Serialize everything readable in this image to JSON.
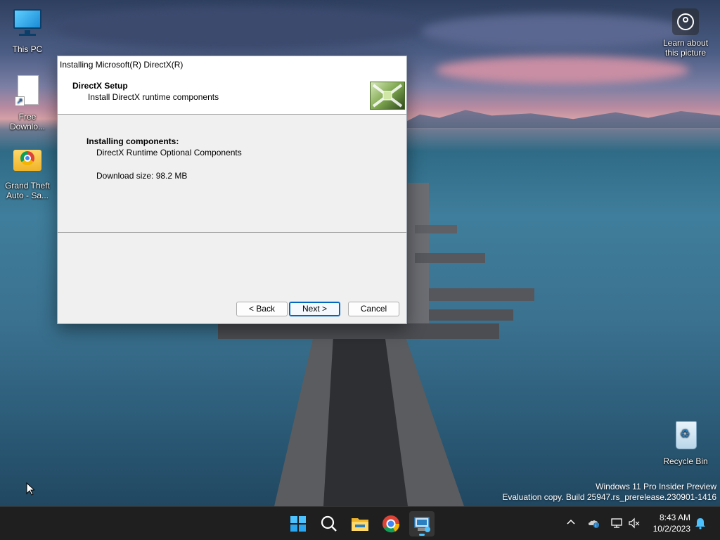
{
  "desktop": {
    "icons": [
      {
        "label": "This PC"
      },
      {
        "label": "Free Downlo..."
      },
      {
        "label": "Grand Theft Auto - Sa..."
      },
      {
        "label": "Recycle Bin"
      }
    ],
    "learn_about": {
      "label": "Learn about this picture"
    }
  },
  "dialog": {
    "title": "Installing Microsoft(R) DirectX(R)",
    "header_title": "DirectX Setup",
    "header_subtitle": "Install DirectX runtime components",
    "body_heading": "Installing components:",
    "component": "DirectX Runtime Optional Components",
    "download_size": "Download size: 98.2 MB",
    "buttons": {
      "back": "< Back",
      "next": "Next >",
      "cancel": "Cancel"
    }
  },
  "watermark": {
    "line1": "Windows 11 Pro Insider Preview",
    "line2": "Evaluation copy. Build 25947.rs_prerelease.230901-1416"
  },
  "taskbar": {
    "apps": [
      "start-icon",
      "search-icon",
      "file-explorer-icon",
      "chrome-icon",
      "directx-setup-icon"
    ],
    "tray": {
      "time": "8:43 AM",
      "date": "10/2/2023"
    }
  },
  "colors": {
    "accent": "#0067c0",
    "taskbar": "#1f1f1f",
    "dialog_bg": "#f0f0f0"
  }
}
